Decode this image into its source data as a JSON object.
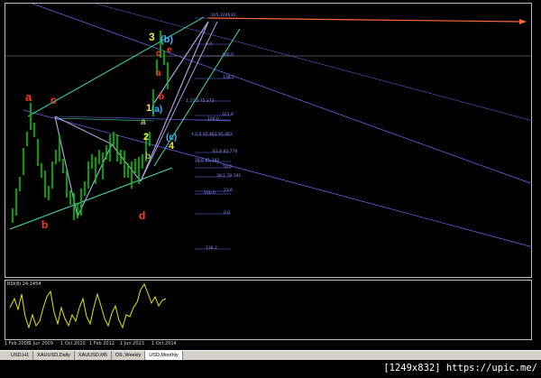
{
  "colors": {
    "background": "#000000",
    "candles": "#00c800",
    "fib_lines": "#6e6eff",
    "channel": "#40e0b0",
    "arrow": "#ff6a3c",
    "rsi": "#e6e600",
    "wave_abc": "#ff3c1e",
    "wave_numbers": "#f0e640",
    "wave_paren": "#3cb4ff",
    "wave_small": "#9ad04a"
  },
  "chart_data": {
    "type": "candlestick",
    "symbol": "USD",
    "period": "Monthly",
    "x_labels": [
      "1 Feb 2008",
      "1 Jun 2009",
      "1 Oct 2010",
      "1 Feb 2012",
      "1 Jun 2013",
      "1 Oct 2014"
    ],
    "price_level_labels": [
      "105.104630",
      "0.0",
      "100.0",
      "138.2",
      "1.27.2 75.373",
      "161.8",
      "100.0",
      "4.0.0 95.463 95.463",
      "61.8 83.778",
      "78.6 81.382",
      "50.0",
      "38.2 78.181",
      "23.6",
      "100.0",
      "0.0",
      "138.2"
    ],
    "wave_labels": [
      {
        "text": "a",
        "color": "wave_abc"
      },
      {
        "text": "c",
        "color": "wave_abc"
      },
      {
        "text": "b",
        "color": "wave_abc"
      },
      {
        "text": "d",
        "color": "wave_abc"
      },
      {
        "text": "3",
        "color": "wave_numbers"
      },
      {
        "text": "(b)",
        "color": "wave_paren"
      },
      {
        "text": "c",
        "color": "wave_abc"
      },
      {
        "text": "e",
        "color": "wave_abc"
      },
      {
        "text": "a",
        "color": "wave_abc"
      },
      {
        "text": "b",
        "color": "wave_abc"
      },
      {
        "text": "1",
        "color": "wave_numbers"
      },
      {
        "text": "(a)",
        "color": "wave_paren"
      },
      {
        "text": "a",
        "color": "wave_small"
      },
      {
        "text": "2",
        "color": "wave_numbers"
      },
      {
        "text": "b",
        "color": "wave_small"
      },
      {
        "text": "(c)",
        "color": "wave_paren"
      },
      {
        "text": "4",
        "color": "wave_numbers"
      }
    ]
  },
  "indicator": {
    "label": "RSI(8) 24.1454"
  },
  "tabs": [
    {
      "label": "USD,H1",
      "active": false
    },
    {
      "label": "XAUUSD,Daily",
      "active": false
    },
    {
      "label": "XAUUSD,M5",
      "active": false
    },
    {
      "label": "OIL,Weekly",
      "active": false
    },
    {
      "label": "USD,Monthly",
      "active": true
    }
  ],
  "watermark": "[1249x832] https://upic.me/"
}
